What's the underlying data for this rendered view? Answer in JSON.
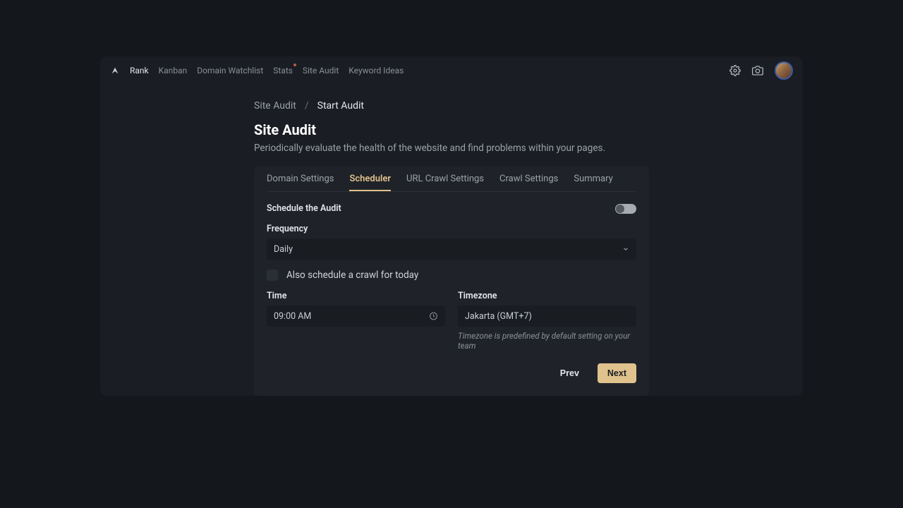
{
  "nav": {
    "items": [
      {
        "label": "Rank",
        "active": true
      },
      {
        "label": "Kanban"
      },
      {
        "label": "Domain Watchlist"
      },
      {
        "label": "Stats",
        "dot": true
      },
      {
        "label": "Site Audit"
      },
      {
        "label": "Keyword Ideas"
      }
    ]
  },
  "breadcrumb": {
    "root": "Site Audit",
    "current": "Start Audit"
  },
  "page": {
    "title": "Site Audit",
    "subtitle": "Periodically evaluate the health of the website and find problems within your pages."
  },
  "tabs": [
    {
      "label": "Domain Settings"
    },
    {
      "label": "Scheduler",
      "active": true
    },
    {
      "label": "URL Crawl Settings"
    },
    {
      "label": "Crawl Settings"
    },
    {
      "label": "Summary"
    }
  ],
  "form": {
    "schedule_label": "Schedule the Audit",
    "frequency_label": "Frequency",
    "frequency_value": "Daily",
    "crawl_today_label": "Also schedule a crawl for today",
    "time_label": "Time",
    "time_value": "09:00 AM",
    "timezone_label": "Timezone",
    "timezone_value": "Jakarta (GMT+7)",
    "timezone_hint": "Timezone is predefined by default setting on your team"
  },
  "actions": {
    "prev": "Prev",
    "next": "Next"
  }
}
